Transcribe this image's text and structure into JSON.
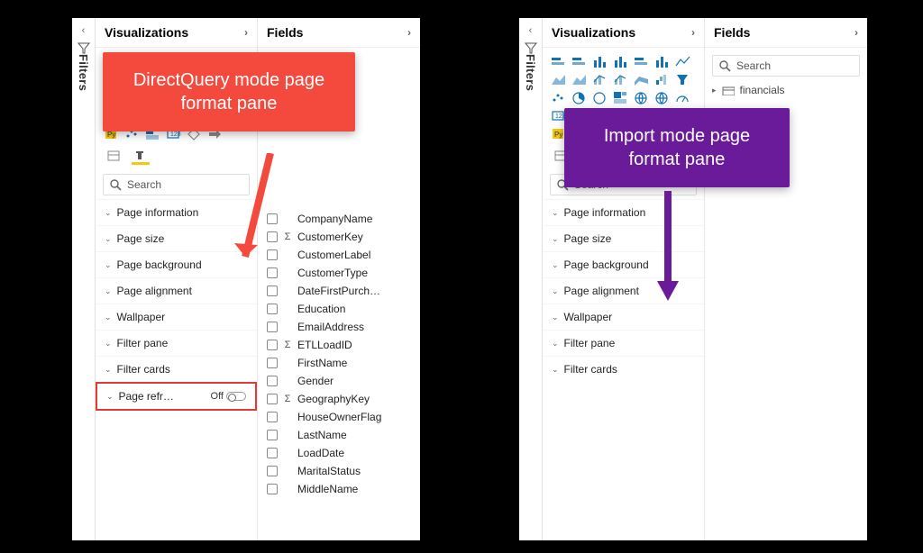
{
  "filters_label": "Filters",
  "left": {
    "callout": "DirectQuery mode page format pane",
    "viz_header": "Visualizations",
    "fields_header": "Fields",
    "search_placeholder": "Search",
    "format_sections": [
      "Page information",
      "Page size",
      "Page background",
      "Page alignment",
      "Wallpaper",
      "Filter pane",
      "Filter cards"
    ],
    "page_refresh_label": "Page refr…",
    "page_refresh_state": "Off",
    "fields": [
      {
        "sigma": false,
        "label": "CompanyName"
      },
      {
        "sigma": true,
        "label": "CustomerKey"
      },
      {
        "sigma": false,
        "label": "CustomerLabel"
      },
      {
        "sigma": false,
        "label": "CustomerType"
      },
      {
        "sigma": false,
        "label": "DateFirstPurch…"
      },
      {
        "sigma": false,
        "label": "Education"
      },
      {
        "sigma": false,
        "label": "EmailAddress"
      },
      {
        "sigma": true,
        "label": "ETLLoadID"
      },
      {
        "sigma": false,
        "label": "FirstName"
      },
      {
        "sigma": false,
        "label": "Gender"
      },
      {
        "sigma": true,
        "label": "GeographyKey"
      },
      {
        "sigma": false,
        "label": "HouseOwnerFlag"
      },
      {
        "sigma": false,
        "label": "LastName"
      },
      {
        "sigma": false,
        "label": "LoadDate"
      },
      {
        "sigma": false,
        "label": "MaritalStatus"
      },
      {
        "sigma": false,
        "label": "MiddleName"
      }
    ]
  },
  "right": {
    "callout": "Import mode page format pane",
    "viz_header": "Visualizations",
    "fields_header": "Fields",
    "search_placeholder": "Search",
    "search_placeholder_fields": "Search",
    "table_name": "financials",
    "format_sections": [
      "Page information",
      "Page size",
      "Page background",
      "Page alignment",
      "Wallpaper",
      "Filter pane",
      "Filter cards"
    ]
  }
}
